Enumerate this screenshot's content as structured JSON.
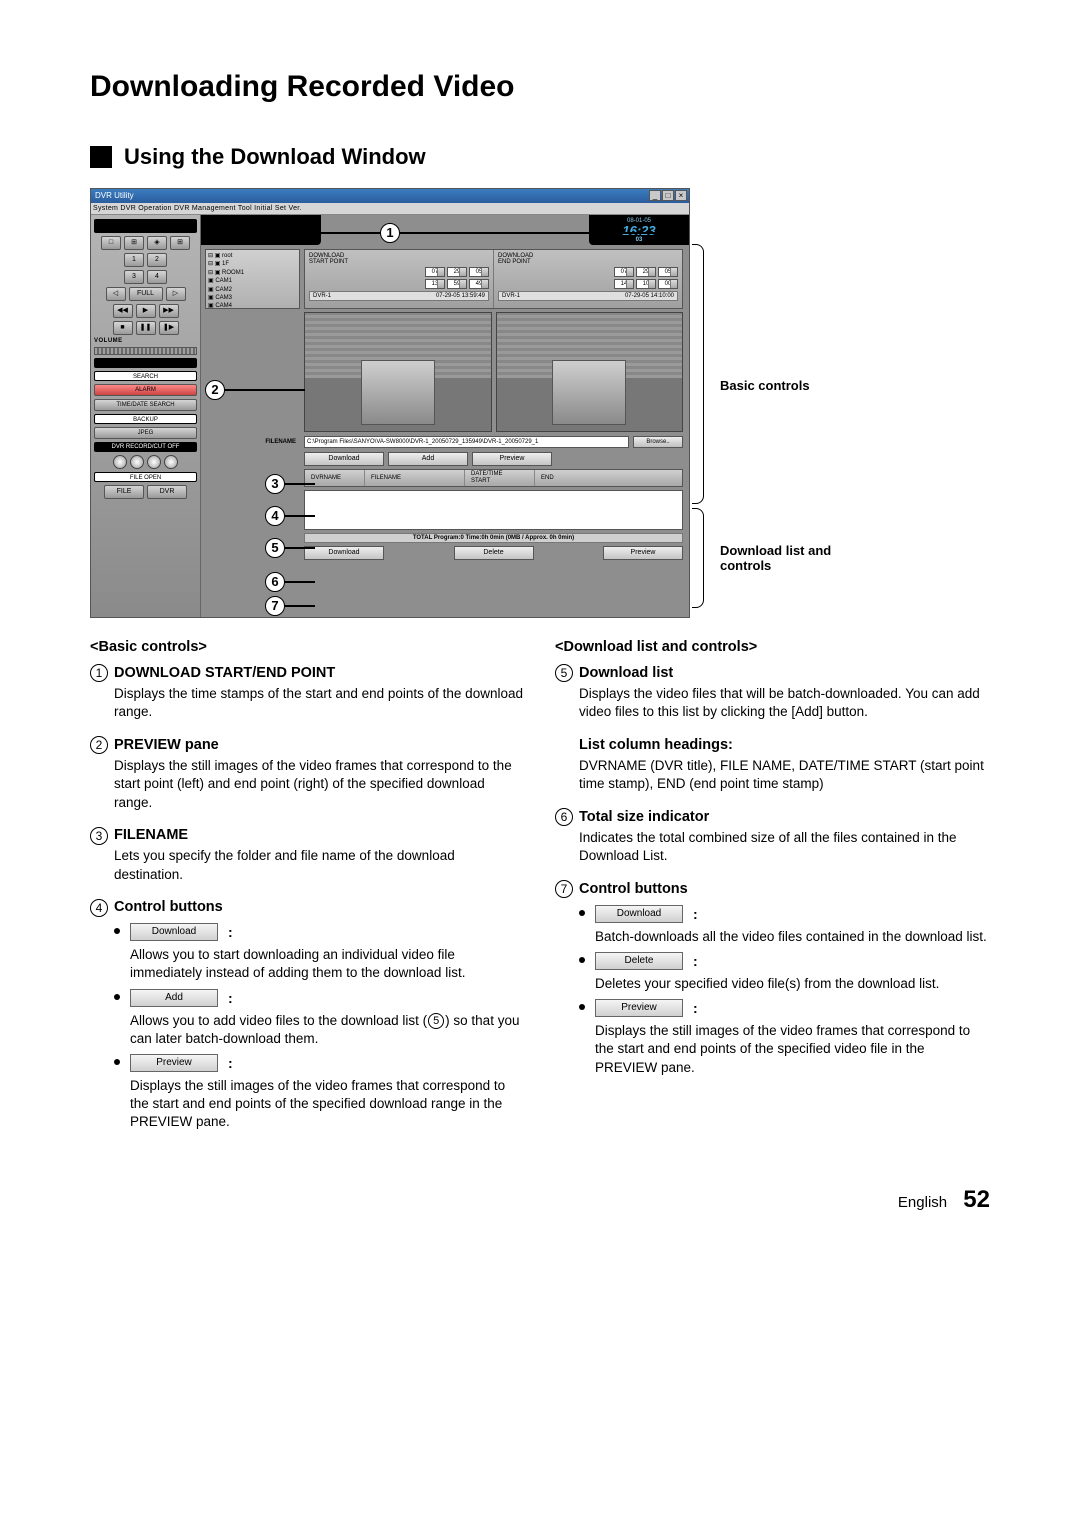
{
  "page": {
    "title": "Downloading Recorded Video",
    "section": "Using the Download Window",
    "footer_lang": "English",
    "footer_page": "52"
  },
  "screenshot": {
    "window_title": "DVR Utility",
    "menubar": "System   DVR Operation   DVR Management   Tool   Initial Set   Ver.",
    "clock": {
      "date": "08-01-05",
      "time": "16:23",
      "sec": "03"
    },
    "left": {
      "btn1": "1",
      "btn2": "2",
      "btn3": "3",
      "btn4": "4",
      "full": "FULL",
      "volume_label": "VOLUME",
      "search": "SEARCH",
      "alarm": "ALARM",
      "timedate": "TIME/DATE SEARCH",
      "backup": "BACKUP",
      "jpeg": "JPEG",
      "rec": "DVR RECORD/CUT OFF",
      "fileopen": "FILE OPEN",
      "file": "FILE",
      "dvr": "DVR",
      "sq1": "□",
      "sq2": "⊞",
      "sq3": "◈",
      "sq4": "⊞"
    },
    "tree": {
      "root": "⊟ ▣ root",
      "floor": "  ⊟ ▣ 1F",
      "room": "    ⊟ ▣ ROOM1",
      "cam1": "      ▣ CAM1",
      "cam2": "      ▣ CAM2",
      "cam3": "      ▣ CAM3",
      "cam4": "      ▣ CAM4"
    },
    "download": {
      "start_label": "DOWNLOAD\nSTART POINT",
      "end_label": "DOWNLOAD\nEND POINT",
      "start_spin": {
        "d1": "07",
        "d2": "29",
        "d3": "05",
        "t1": "13",
        "t2": "59",
        "t3": "49"
      },
      "end_spin": {
        "d1": "07",
        "d2": "29",
        "d3": "05",
        "t1": "14",
        "t2": "10",
        "t3": "00"
      },
      "dvrname_start": "DVR-1",
      "ts_start": "07-29-05 13:59:49",
      "dvrname_end": "DVR-1",
      "ts_end": "07-29-05 14:10:00",
      "filename_label": "FILENAME",
      "filename_value": "C:\\Program Files\\SANYO\\VA-SW8000\\DVR-1_20050729_135949\\DVR-1_20050729_1",
      "browse": "Browse..",
      "btn_download": "Download",
      "btn_add": "Add",
      "btn_preview": "Preview",
      "list_hdr": {
        "c1": "DVRNAME",
        "c2": "FILENAME",
        "c3": "DATE/TIME\nSTART",
        "c4": "END"
      },
      "total": "TOTAL Program:0 Time:0h 0min (0MB / Approx. 0h 0min)",
      "list_btn_download": "Download",
      "list_btn_delete": "Delete",
      "list_btn_preview": "Preview"
    }
  },
  "annotations": {
    "brace_basic": "Basic controls",
    "brace_list": "Download list and controls",
    "c1": "1",
    "c2": "2",
    "c3": "3",
    "c4": "4",
    "c5": "5",
    "c6": "6",
    "c7": "7"
  },
  "left_col": {
    "header": "<Basic controls>",
    "i1_title": "DOWNLOAD START/END POINT",
    "i1_desc": "Displays the time stamps of the start and end points of the download range.",
    "i2_title": "PREVIEW pane",
    "i2_desc": "Displays the still images of the video frames that correspond to the start point (left) and end point (right) of the specified download range.",
    "i3_title": "FILENAME",
    "i3_desc": "Lets you specify the folder and file name of the download destination.",
    "i4_title": "Control buttons",
    "i4a_btn": "Download",
    "i4a_desc": "Allows you to start downloading an individual video file immediately instead of adding them to the download list.",
    "i4b_btn": "Add",
    "i4b_desc_1": "Allows you to add video files to the download list (",
    "i4b_desc_num": "5",
    "i4b_desc_2": ") so that you can later batch-download them.",
    "i4c_btn": "Preview",
    "i4c_desc": "Displays the still images of the video frames that correspond to the start and end points of the specified download range in the PREVIEW pane."
  },
  "right_col": {
    "header": "<Download list and controls>",
    "i5_title": "Download list",
    "i5_desc": "Displays the video files that will be batch-downloaded. You can add video files to this list by clicking the [Add] button.",
    "listhdr_title": "List column headings:",
    "listhdr_desc": "DVRNAME (DVR title), FILE NAME, DATE/TIME START (start point time stamp), END (end point time stamp)",
    "i6_title": "Total size indicator",
    "i6_desc": "Indicates the total combined size of all the files contained in the Download List.",
    "i7_title": "Control buttons",
    "i7a_btn": "Download",
    "i7a_desc": "Batch-downloads all the video files contained in the download list.",
    "i7b_btn": "Delete",
    "i7b_desc": "Deletes your specified video file(s) from the download list.",
    "i7c_btn": "Preview",
    "i7c_desc": "Displays the still images of the video frames that correspond to the start and end points of the specified video file in the PREVIEW pane."
  }
}
